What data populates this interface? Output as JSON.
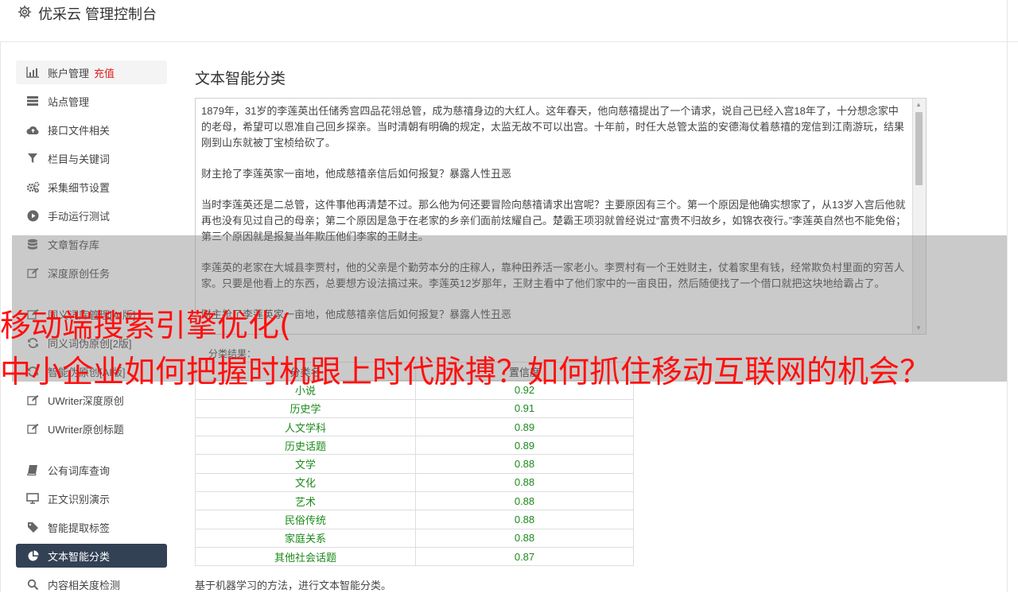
{
  "header": {
    "title": "优采云 管理控制台",
    "icon": "gear-icon"
  },
  "sidebar": {
    "items": [
      {
        "label": "账户管理",
        "extra": "充值",
        "icon": "bar-chart-icon"
      },
      {
        "label": "站点管理",
        "icon": "server-icon"
      },
      {
        "label": "接口文件相关",
        "icon": "cloud-upload-icon"
      },
      {
        "label": "栏目与关键词",
        "icon": "filter-icon"
      },
      {
        "label": "采集细节设置",
        "icon": "cogs-icon"
      },
      {
        "label": "手动运行测试",
        "icon": "play-circle-icon"
      },
      {
        "label": "文章暂存库",
        "icon": "database-icon"
      },
      {
        "label": "深度原创任务",
        "icon": "edit-icon"
      },
      {
        "label": "同义词库管理[AI版]",
        "icon": "edit-icon"
      },
      {
        "label": "同义词伪原创[2版]",
        "icon": "refresh-icon"
      },
      {
        "label": "智能伪原创[AI版]",
        "icon": "refresh-icon"
      },
      {
        "label": "UWriter深度原创",
        "icon": "edit-icon"
      },
      {
        "label": "UWriter原创标题",
        "icon": "edit-icon"
      },
      {
        "label": "公有词库查询",
        "icon": "book-icon"
      },
      {
        "label": "正文识别演示",
        "icon": "monitor-icon"
      },
      {
        "label": "智能提取标签",
        "icon": "tag-icon"
      },
      {
        "label": "文本智能分类",
        "icon": "pie-chart-icon"
      },
      {
        "label": "内容相关度检测",
        "icon": "search-icon"
      }
    ]
  },
  "main": {
    "title": "文本智能分类",
    "text_paragraphs": [
      "1879年，31岁的李莲英出任储秀宫四品花翎总管，成为慈禧身边的大红人。这年春天，他向慈禧提出了一个请求，说自己已经入宫18年了，十分想念家中的老母，希望可以恩准自己回乡探亲。当时清朝有明确的规定，太监无故不可以出宫。十年前，时任大总管太监的安德海仗着慈禧的宠信到江南游玩，结果刚到山东就被丁宝桢给砍了。",
      "财主抢了李莲英家一亩地，他成慈禧亲信后如何报复？暴露人性丑恶",
      "当时李莲英还是二总管，这件事他再清楚不过。那么他为何还要冒险向慈禧请求出宫呢？主要原因有三个。第一个原因是他确实想家了，从13岁入宫后他就再也没有见过自己的母亲；第二个原因是急于在老家的乡亲们面前炫耀自己。楚霸王项羽就曾经说过“富贵不归故乡，如锦衣夜行。”李莲英自然也不能免俗；第三个原因就是报复当年欺压他们李家的王财主。",
      "李莲英的老家在大城县李贾村，他的父亲是个勤劳本分的庄稼人，靠种田养活一家老小。李贾村有一个王姓财主，仗着家里有钱，经常欺负村里面的穷苦人家。只要是他看上的东西，总要想方设法搞过来。李莲英12岁那年，王财主看中了他们家中的一亩良田，然后随便找了一个借口就把这块地给霸占了。",
      "财主抢了李莲英家一亩地，他成慈禧亲信后如何报复？暴露人性丑恶"
    ],
    "result_label": "分类结果：",
    "table": {
      "headers": [
        "分类名",
        "置信度"
      ],
      "rows": [
        [
          "小说",
          "0.92"
        ],
        [
          "历史学",
          "0.91"
        ],
        [
          "人文学科",
          "0.89"
        ],
        [
          "历史话题",
          "0.89"
        ],
        [
          "文学",
          "0.88"
        ],
        [
          "文化",
          "0.88"
        ],
        [
          "艺术",
          "0.88"
        ],
        [
          "民俗传统",
          "0.88"
        ],
        [
          "家庭关系",
          "0.88"
        ],
        [
          "其他社会话题",
          "0.87"
        ]
      ]
    },
    "footer_note": "基于机器学习的方法，进行文本智能分类。"
  },
  "overlay": {
    "line1": "移动端搜索引擎优化(",
    "line2": "中小企业如何把握时机跟上时代脉搏？如何抓住移动互联网的机会？"
  },
  "colors": {
    "active_bg": "#334155",
    "score_green": "#1b8a1b",
    "overlay_red": "#ff1010",
    "extra_red": "#e02020"
  }
}
